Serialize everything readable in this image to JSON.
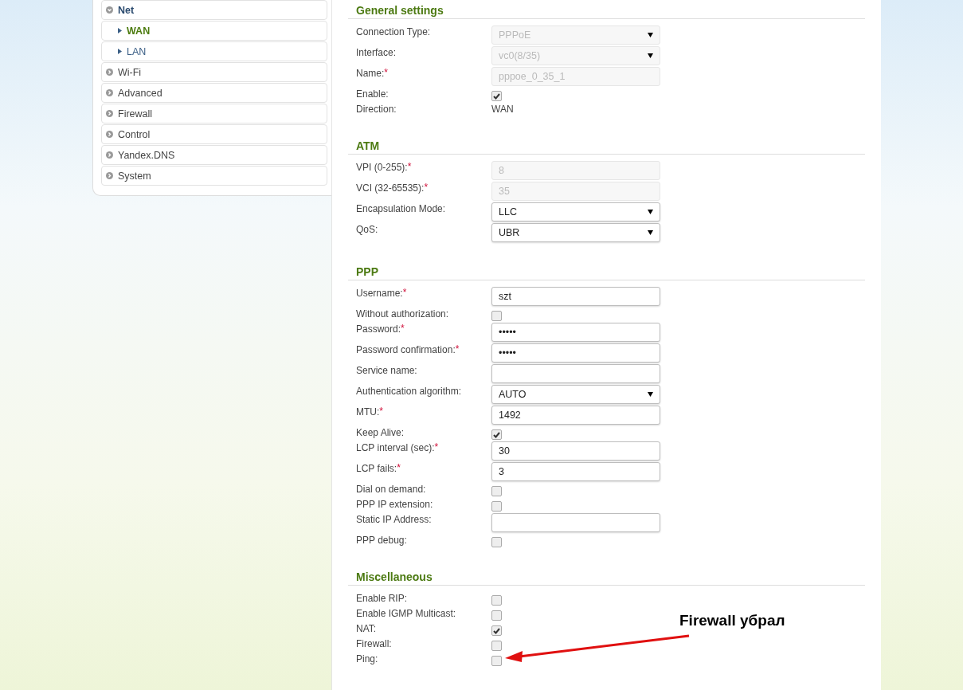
{
  "sidebar": {
    "items": [
      {
        "label": "Net",
        "kind": "group",
        "expanded": true,
        "children": [
          {
            "label": "WAN",
            "selected": true
          },
          {
            "label": "LAN",
            "selected": false
          }
        ]
      },
      {
        "label": "Wi-Fi",
        "kind": "group",
        "expanded": false
      },
      {
        "label": "Advanced",
        "kind": "group",
        "expanded": false
      },
      {
        "label": "Firewall",
        "kind": "group",
        "expanded": false
      },
      {
        "label": "Control",
        "kind": "group",
        "expanded": false
      },
      {
        "label": "Yandex.DNS",
        "kind": "group",
        "expanded": false
      },
      {
        "label": "System",
        "kind": "group",
        "expanded": false
      }
    ]
  },
  "sections": [
    {
      "title": "General settings",
      "rows": [
        {
          "kind": "select",
          "label": "Connection Type:",
          "value": "PPPoE",
          "disabled": true
        },
        {
          "kind": "select",
          "label": "Interface:",
          "value": "vc0(8/35)",
          "disabled": true
        },
        {
          "kind": "input",
          "label": "Name:",
          "mark": "*",
          "value": "pppoe_0_35_1",
          "disabled": true
        },
        {
          "kind": "checkbox",
          "label": "Enable:",
          "checked": true
        },
        {
          "kind": "text",
          "label": "Direction:",
          "value": "WAN"
        }
      ]
    },
    {
      "title": "ATM",
      "rows": [
        {
          "kind": "input",
          "label": "VPI (0-255):",
          "mark": "*",
          "value": "8",
          "disabled": true
        },
        {
          "kind": "input",
          "label": "VCI (32-65535):",
          "mark": "*",
          "value": "35",
          "disabled": true
        },
        {
          "kind": "select",
          "label": "Encapsulation Mode:",
          "value": "LLC",
          "disabled": false
        },
        {
          "kind": "select",
          "label": "QoS:",
          "value": "UBR",
          "disabled": false
        }
      ]
    },
    {
      "title": "PPP",
      "rows": [
        {
          "kind": "input",
          "label": "Username:",
          "mark": "*",
          "value": "szt",
          "disabled": false
        },
        {
          "kind": "checkbox",
          "label": "Without authorization:",
          "checked": false
        },
        {
          "kind": "input",
          "label": "Password:",
          "mark": "*",
          "value": "•••••",
          "disabled": false
        },
        {
          "kind": "input",
          "label": "Password confirmation:",
          "mark": "*",
          "value": "•••••",
          "disabled": false
        },
        {
          "kind": "input",
          "label": "Service name:",
          "disabled": false
        },
        {
          "kind": "select",
          "label": "Authentication algorithm:",
          "value": "AUTO",
          "disabled": false
        },
        {
          "kind": "input",
          "label": "MTU:",
          "mark": "*",
          "value": "1492",
          "disabled": false
        },
        {
          "kind": "checkbox",
          "label": "Keep Alive:",
          "checked": true
        },
        {
          "kind": "input",
          "label": "LCP interval (sec):",
          "mark": "*",
          "value": "30",
          "disabled": false
        },
        {
          "kind": "input",
          "label": "LCP fails:",
          "mark": "*",
          "value": "3",
          "disabled": false
        },
        {
          "kind": "checkbox",
          "label": "Dial on demand:",
          "checked": false
        },
        {
          "kind": "checkbox",
          "label": "PPP IP extension:",
          "checked": false
        },
        {
          "kind": "input",
          "label": "Static IP Address:",
          "disabled": false
        },
        {
          "kind": "checkbox",
          "label": "PPP debug:",
          "checked": false
        }
      ]
    },
    {
      "title": "Miscellaneous",
      "rows": [
        {
          "kind": "checkbox",
          "label": "Enable RIP:",
          "checked": false
        },
        {
          "kind": "checkbox",
          "label": "Enable IGMP Multicast:",
          "checked": false
        },
        {
          "kind": "checkbox",
          "label": "NAT:",
          "checked": true
        },
        {
          "kind": "checkbox",
          "label": "Firewall:",
          "checked": false
        },
        {
          "kind": "checkbox",
          "label": "Ping:",
          "checked": false
        }
      ]
    }
  ],
  "annotation": {
    "text": "Firewall убрал"
  }
}
